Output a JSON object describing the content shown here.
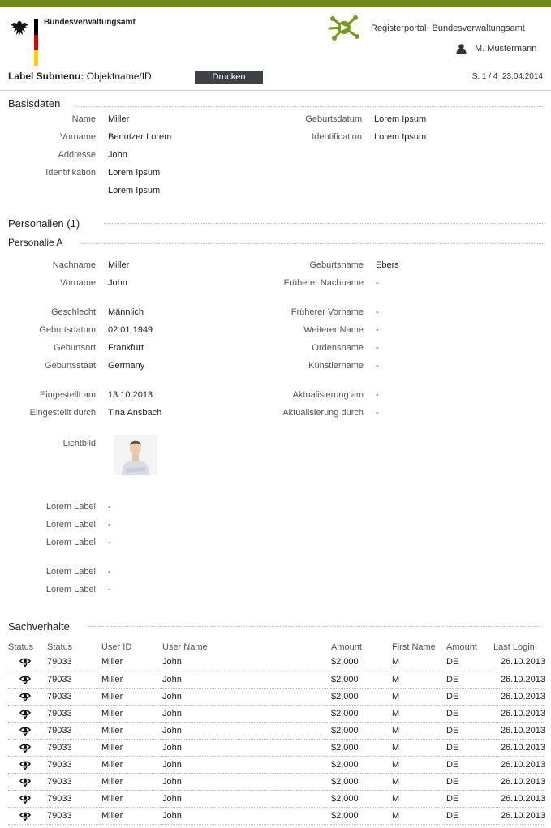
{
  "header": {
    "agency": "Bundesverwaltungsamt",
    "portal_name": "Registerportal",
    "portal_agency": "Bundesverwaltungsamt",
    "user_name": "M. Mustermann",
    "brand_color": "#6f8a19"
  },
  "submenu": {
    "label": "Label Submenu:",
    "object": "Objektname/ID",
    "print_label": "Drucken",
    "page": "S. 1 / 4",
    "date": "23.04.2014"
  },
  "basisdaten": {
    "title": "Basisdaten",
    "left": [
      {
        "label": "Name",
        "value": "Miller"
      },
      {
        "label": "Vorname",
        "value": "Benutzer Lorem"
      },
      {
        "label": "Addresse",
        "value": "John"
      },
      {
        "label": "Identifikation",
        "value": "Lorem Ipsum"
      },
      {
        "label": "",
        "value": "Lorem Ipsum"
      }
    ],
    "right": [
      {
        "label": "Geburtsdatum",
        "value": "Lorem Ipsum"
      },
      {
        "label": "Identification",
        "value": "Lorem Ipsum"
      }
    ]
  },
  "personalien": {
    "title": "Personalien (1)",
    "subtitle": "Personalie A",
    "left": [
      {
        "label": "Nachname",
        "value": "Miller"
      },
      {
        "label": "Vorname",
        "value": "John"
      },
      {
        "label": "Geschlecht",
        "value": "Männlich"
      },
      {
        "label": "Geburtsdatum",
        "value": "02.01.1949"
      },
      {
        "label": "Geburtsort",
        "value": "Frankfurt"
      },
      {
        "label": "Geburtsstaat",
        "value": "Germany"
      },
      {
        "label": "Eingestellt am",
        "value": "13.10.2013"
      },
      {
        "label": "Eingestellt durch",
        "value": "Tina Ansbach"
      }
    ],
    "right": [
      {
        "label": "Geburtsname",
        "value": "Ebers"
      },
      {
        "label": "Früherer Nachname",
        "value": "-"
      },
      {
        "label": "Früherer Vorname",
        "value": "-"
      },
      {
        "label": "Weiterer Name",
        "value": "-"
      },
      {
        "label": "Ordensname",
        "value": "-"
      },
      {
        "label": "Künstlername",
        "value": "-"
      },
      {
        "label": "Aktualisierung am",
        "value": "-"
      },
      {
        "label": "Aktualisierung durch",
        "value": "-"
      }
    ],
    "photo_label": "Lichtbild",
    "extra": [
      {
        "label": "Lorem Label",
        "value": "-"
      },
      {
        "label": "Lorem Label",
        "value": "-"
      },
      {
        "label": "Lorem Label",
        "value": "-"
      },
      {
        "label": "Lorem Label",
        "value": "-"
      },
      {
        "label": "Lorem Label",
        "value": "-"
      }
    ]
  },
  "sachverhalte": {
    "title": "Sachverhalte",
    "columns": [
      "Status",
      "Status",
      "User ID",
      "User Name",
      "Amount",
      "First Name",
      "Amount",
      "Last Login"
    ],
    "rows": [
      {
        "status": "79033",
        "user_id": "Miller",
        "user_name": "John",
        "amount": "$2,000",
        "first_name": "M",
        "amount2": "DE",
        "last_login": "26.10.2013"
      },
      {
        "status": "79033",
        "user_id": "Miller",
        "user_name": "John",
        "amount": "$2,000",
        "first_name": "M",
        "amount2": "DE",
        "last_login": "26.10.2013"
      },
      {
        "status": "79033",
        "user_id": "Miller",
        "user_name": "John",
        "amount": "$2,000",
        "first_name": "M",
        "amount2": "DE",
        "last_login": "26.10.2013"
      },
      {
        "status": "79033",
        "user_id": "Miller",
        "user_name": "John",
        "amount": "$2,000",
        "first_name": "M",
        "amount2": "DE",
        "last_login": "26.10.2013"
      },
      {
        "status": "79033",
        "user_id": "Miller",
        "user_name": "John",
        "amount": "$2,000",
        "first_name": "M",
        "amount2": "DE",
        "last_login": "26.10.2013"
      },
      {
        "status": "79033",
        "user_id": "Miller",
        "user_name": "John",
        "amount": "$2,000",
        "first_name": "M",
        "amount2": "DE",
        "last_login": "26.10.2013"
      },
      {
        "status": "79033",
        "user_id": "Miller",
        "user_name": "John",
        "amount": "$2,000",
        "first_name": "M",
        "amount2": "DE",
        "last_login": "26.10.2013"
      },
      {
        "status": "79033",
        "user_id": "Miller",
        "user_name": "John",
        "amount": "$2,000",
        "first_name": "M",
        "amount2": "DE",
        "last_login": "26.10.2013"
      },
      {
        "status": "79033",
        "user_id": "Miller",
        "user_name": "John",
        "amount": "$2,000",
        "first_name": "M",
        "amount2": "DE",
        "last_login": "26.10.2013"
      },
      {
        "status": "79033",
        "user_id": "Miller",
        "user_name": "John",
        "amount": "$2,000",
        "first_name": "M",
        "amount2": "DE",
        "last_login": "26.10.2013"
      }
    ]
  }
}
